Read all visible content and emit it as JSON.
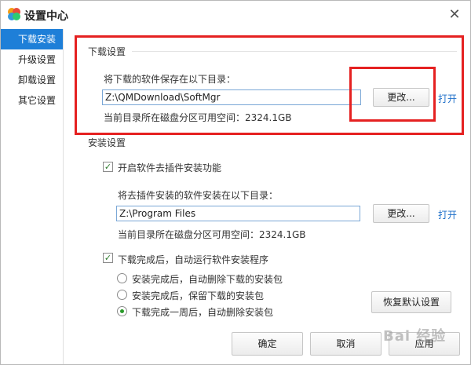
{
  "window": {
    "title": "设置中心"
  },
  "sidebar": {
    "items": [
      {
        "label": "下载安装"
      },
      {
        "label": "升级设置"
      },
      {
        "label": "卸载设置"
      },
      {
        "label": "其它设置"
      }
    ]
  },
  "download": {
    "section_title": "下载设置",
    "dir_label": "将下载的软件保存在以下目录：",
    "path": "Z:\\QMDownload\\SoftMgr",
    "change_label": "更改...",
    "open_label": "打开",
    "free_space": "当前目录所在磁盘分区可用空间：2324.1GB"
  },
  "install": {
    "section_title": "安装设置",
    "plugin_checkbox_label": "开启软件去插件安装功能",
    "plugin_checked": true,
    "dir_label": "将去插件安装的软件安装在以下目录：",
    "path": "Z:\\Program Files",
    "change_label": "更改...",
    "open_label": "打开",
    "free_space": "当前目录所在磁盘分区可用空间：2324.1GB",
    "autorun_checkbox_label": "下载完成后，自动运行软件安装程序",
    "autorun_checked": true,
    "radio_options": [
      {
        "label": "安装完成后，自动删除下载的安装包",
        "checked": false
      },
      {
        "label": "安装完成后，保留下载的安装包",
        "checked": false
      },
      {
        "label": "下载完成一周后，自动删除安装包",
        "checked": true
      }
    ],
    "restore_label": "恢复默认设置"
  },
  "footer": {
    "ok_label": "确定",
    "cancel_label": "取消",
    "apply_label": "应用"
  },
  "watermark": {
    "text": "Bai 经验"
  },
  "colors": {
    "accent": "#1e7fd8",
    "highlight": "#e52121",
    "link": "#1e6fc9"
  }
}
